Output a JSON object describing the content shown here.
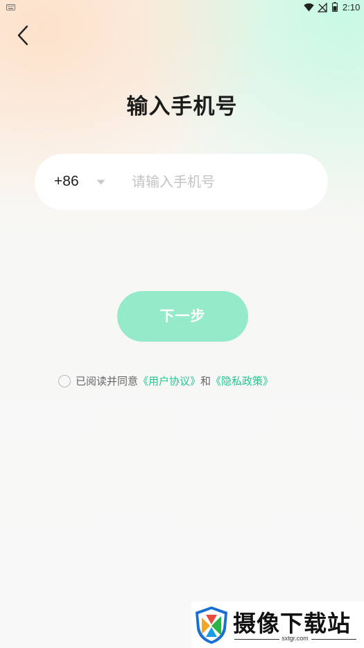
{
  "status_bar": {
    "time": "2:10",
    "icons": [
      "keyboard-icon",
      "wifi-icon",
      "signal-off-icon",
      "battery-icon"
    ]
  },
  "nav": {
    "back_icon": "chevron-left-icon"
  },
  "title": "输入手机号",
  "phone": {
    "country_code": "+86",
    "dropdown_icon": "caret-down-icon",
    "placeholder": "请输入手机号",
    "value": ""
  },
  "next_button": {
    "label": "下一步"
  },
  "agreement": {
    "checked": false,
    "prefix": "已阅读并同意",
    "user_agreement": "《用户协议》",
    "conjunction": "和",
    "privacy_policy": "《隐私政策》"
  },
  "watermark": {
    "title": "摄像下载站",
    "domain": "sxtgr.com"
  },
  "colors": {
    "accent": "#22c88f",
    "button_bg": "#95ebc9",
    "title": "#1b1b1b",
    "placeholder": "#c3c3c3"
  }
}
